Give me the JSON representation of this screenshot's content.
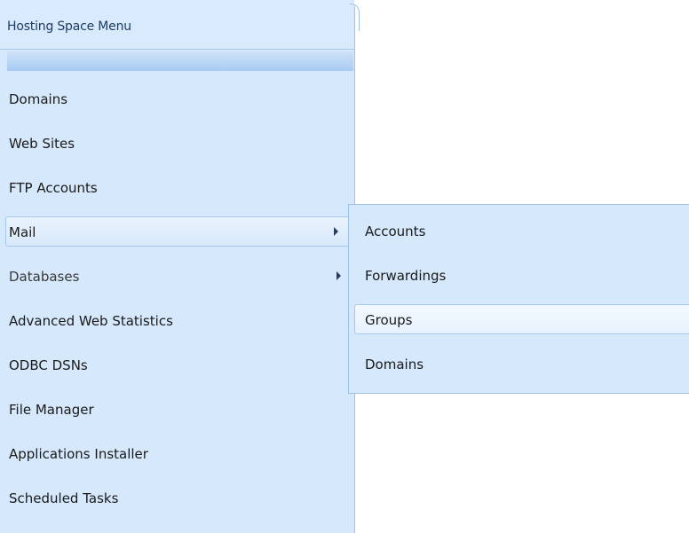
{
  "panel": {
    "title": "Hosting Space Menu"
  },
  "menu": {
    "items": [
      {
        "label": "Domains"
      },
      {
        "label": "Web Sites"
      },
      {
        "label": "FTP Accounts"
      },
      {
        "label": "Mail",
        "has_submenu": true,
        "active": true
      },
      {
        "label": "Databases",
        "has_submenu": true
      },
      {
        "label": "Advanced Web Statistics"
      },
      {
        "label": "ODBC DSNs"
      },
      {
        "label": "File Manager"
      },
      {
        "label": "Applications Installer"
      },
      {
        "label": "Scheduled Tasks"
      }
    ]
  },
  "submenu": {
    "parent": "Mail",
    "items": [
      {
        "label": "Accounts"
      },
      {
        "label": "Forwardings"
      },
      {
        "label": "Groups",
        "hovered": true
      },
      {
        "label": "Domains"
      }
    ]
  },
  "colors": {
    "panel_background": "#d6e8fb",
    "panel_border": "#9fc3e7",
    "title_text": "#1d3b63",
    "item_text": "#1a1a1a",
    "arrow": "#243d61"
  },
  "icons": {
    "submenu_arrow": "triangle-right-icon"
  }
}
